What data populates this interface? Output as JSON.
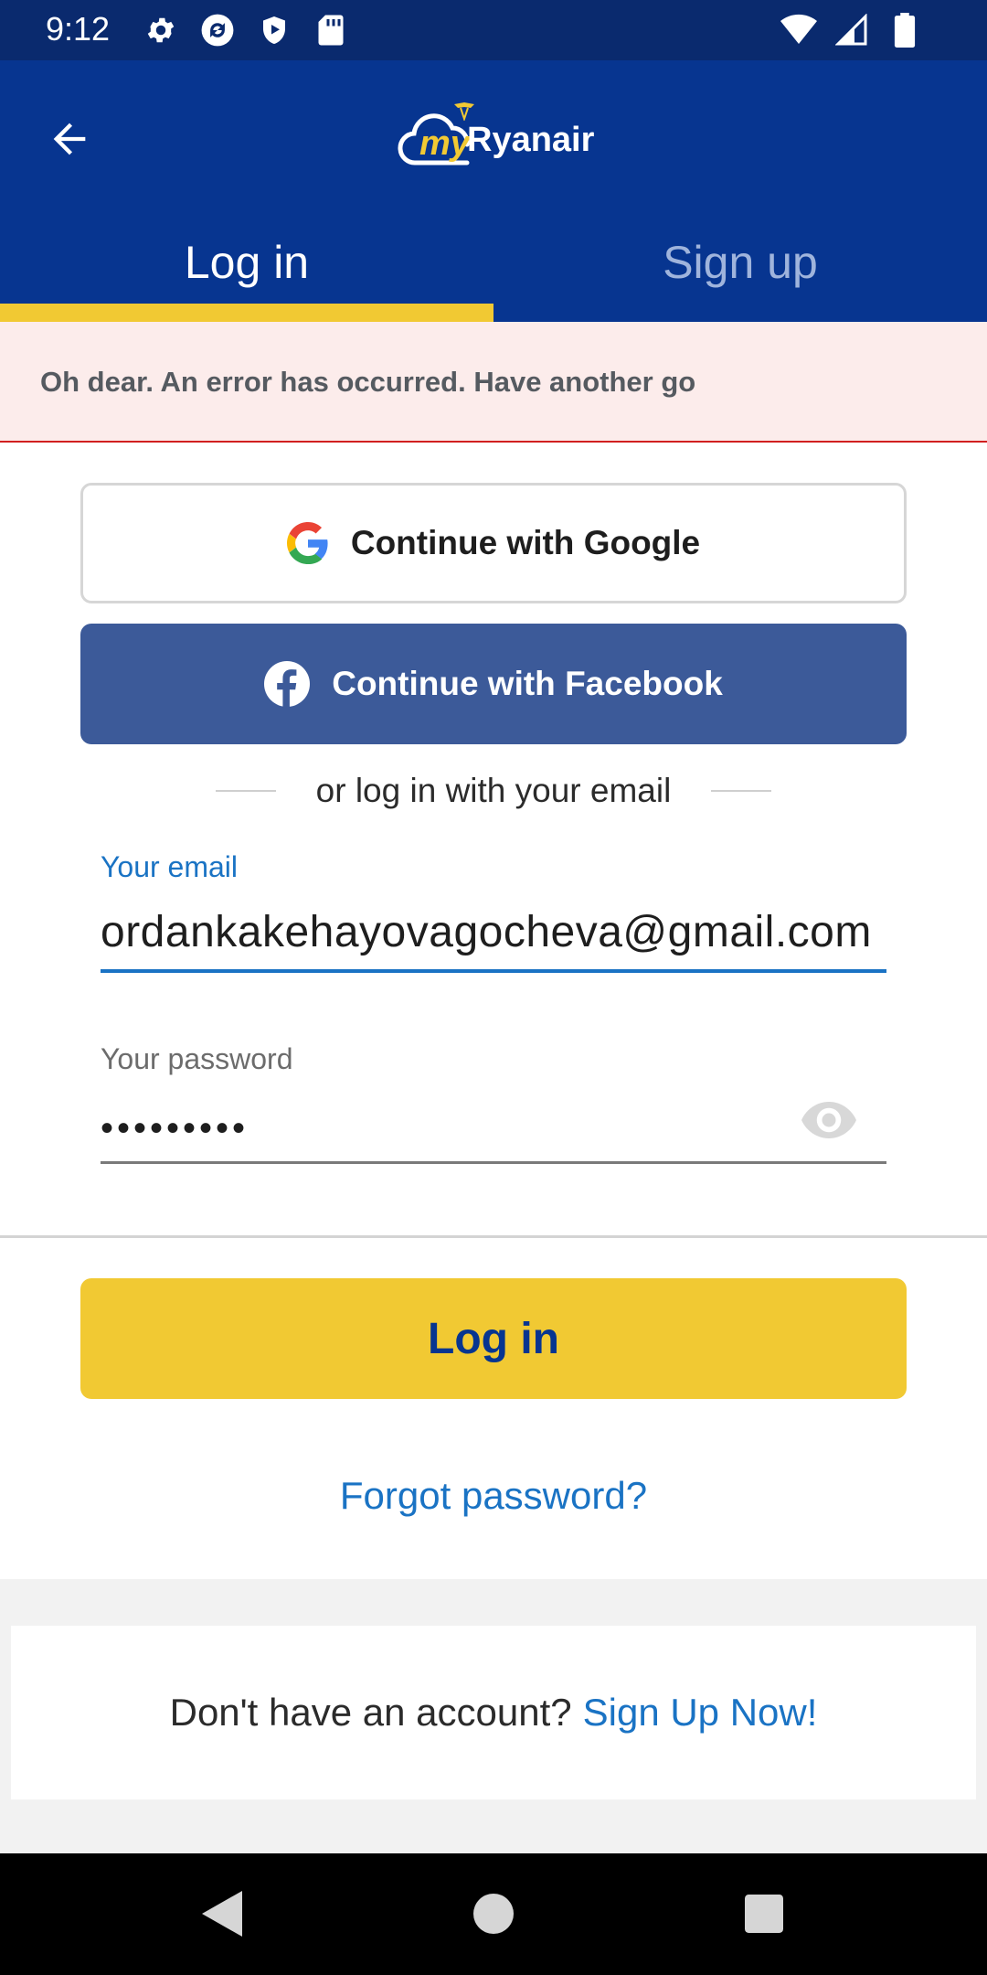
{
  "status_bar": {
    "time": "9:12",
    "icons_left": [
      "settings-icon",
      "sync-icon",
      "shield-play-icon",
      "sd-card-icon"
    ],
    "icons_right": [
      "wifi-icon",
      "signal-icon",
      "battery-icon"
    ]
  },
  "header": {
    "back_icon": "arrow-left-icon",
    "logo_my": "my",
    "logo_name": "Ryanair"
  },
  "tabs": [
    {
      "label": "Log in",
      "active": true
    },
    {
      "label": "Sign up",
      "active": false
    }
  ],
  "error": {
    "message": "Oh dear. An error has occurred. Have another go"
  },
  "social": {
    "google_label": "Continue with Google",
    "facebook_label": "Continue with Facebook"
  },
  "divider_text": "or log in with your email",
  "form": {
    "email_label": "Your email",
    "email_value": "ordankakehayovagocheva@gmail.com",
    "password_label": "Your password",
    "password_value": "•••••••••"
  },
  "login_button": "Log in",
  "forgot_password": "Forgot password?",
  "signup": {
    "prompt": "Don't have an account?",
    "link": "Sign Up Now!"
  },
  "colors": {
    "brand_blue": "#073590",
    "brand_yellow": "#f1c933",
    "link_blue": "#1a73c4",
    "facebook_blue": "#3c5a99",
    "error_red": "#d11f1f"
  }
}
